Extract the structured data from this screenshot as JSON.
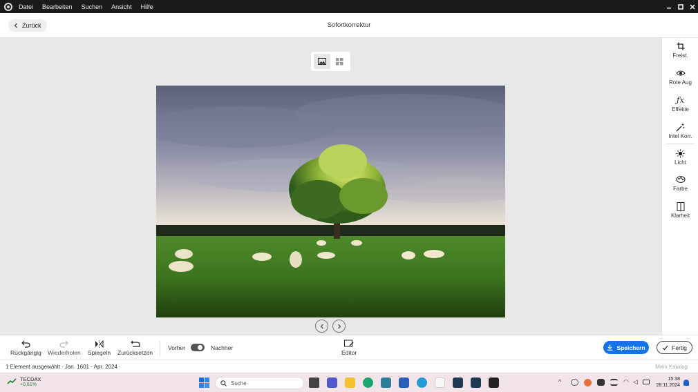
{
  "menubar": {
    "items": [
      "Datei",
      "Bearbeiten",
      "Suchen",
      "Ansicht",
      "Hilfe"
    ],
    "window_controls": [
      "minimize-icon",
      "restore-icon",
      "close-icon"
    ]
  },
  "header": {
    "back_label": "Zurück",
    "title": "Sofortkorrektur"
  },
  "view_toggle": {
    "options": [
      "single-image-icon",
      "grid-icon"
    ],
    "active": "single-image-icon"
  },
  "tools": [
    {
      "label": "Freist.",
      "icon": "crop-icon"
    },
    {
      "label": "Rote Aug",
      "icon": "red-eye-icon"
    },
    {
      "label": "Effekte",
      "icon": "fx-icon"
    },
    {
      "label": "Intel Korr.",
      "icon": "magic-wand-icon"
    },
    {
      "label": "Licht",
      "icon": "sun-icon"
    },
    {
      "label": "Farbe",
      "icon": "color-icon"
    },
    {
      "label": "Klarheit",
      "icon": "clarity-icon"
    }
  ],
  "bottom_toolbar": {
    "undo": "Rückgängig",
    "redo": "Wiederholen",
    "flip": "Spiegeln",
    "reset": "Zurücksetzen",
    "before": "Vorher",
    "after": "Nachher",
    "editor": "Editor",
    "save": "Speichern",
    "done": "Fertig"
  },
  "status": {
    "selection": "1 Element ausgewählt · Jan. 1601 - Apr. 2024 ·",
    "catalog": "Mein Katalog"
  },
  "taskbar": {
    "ticker_name": "TECDAX",
    "ticker_change": "+0,61%",
    "search_placeholder": "Suche",
    "time": "15:38",
    "date": "28.11.2024"
  },
  "colors": {
    "accent": "#1473e6",
    "menubar_bg": "#1b1b1b",
    "canvas_bg": "#e8e8e8",
    "taskbar_bg": "#f3e4ea"
  }
}
